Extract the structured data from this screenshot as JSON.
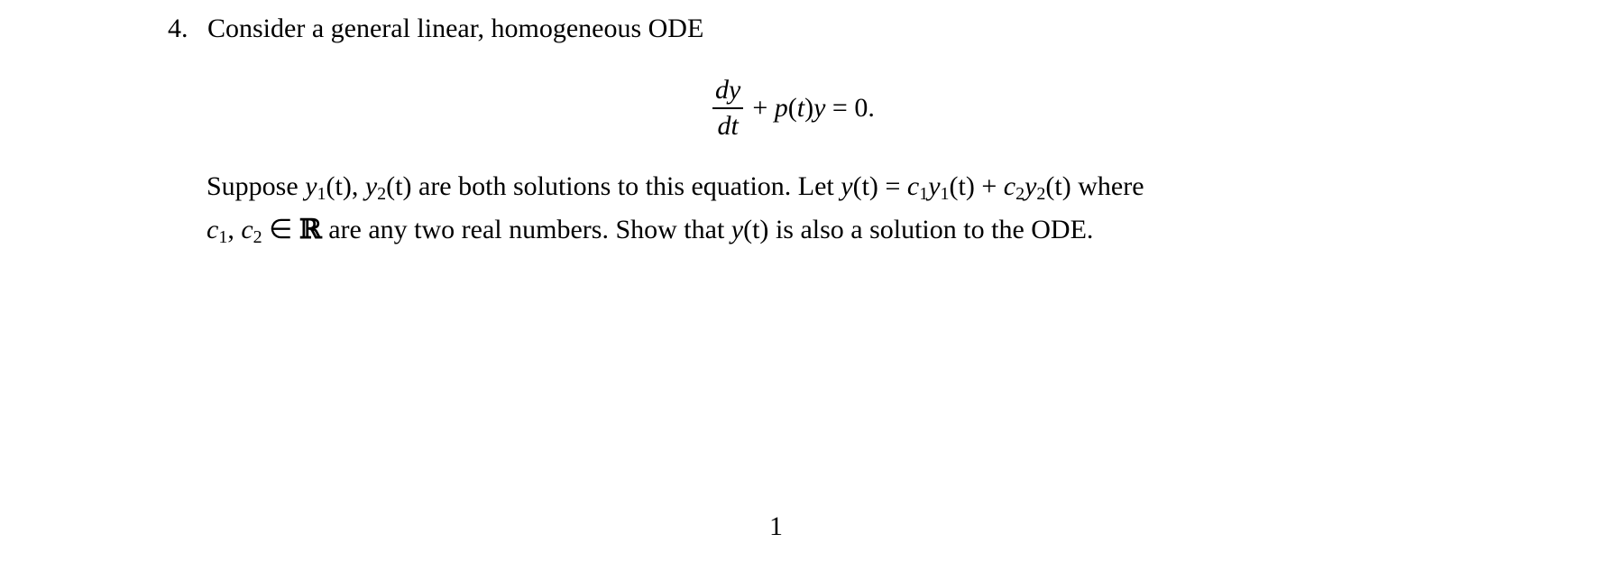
{
  "document": {
    "problem": {
      "number": "4.",
      "lead": "Consider a general linear, homogeneous ODE",
      "equation": {
        "numerator": "dy",
        "denominator": "dt",
        "rest": {
          "plus": "+",
          "p": "p",
          "t_open": "(",
          "t": "t",
          "t_close": ")",
          "y": "y",
          "equals": "=",
          "zero": "0."
        }
      },
      "paragraph": {
        "line1": {
          "suppose": "Suppose",
          "y1": "y",
          "y1_sub": "1",
          "y1_arg": "(t),",
          "y2": "y",
          "y2_sub": "2",
          "y2_arg": "(t)",
          "middle": "are both solutions to this equation. Let",
          "yt": "y",
          "yt_arg": "(t)",
          "equals": "=",
          "c1": "c",
          "c1_sub": "1",
          "c1y1": "y",
          "c1y1_sub": "1",
          "c1y1_arg": "(t)",
          "plus": "+",
          "c2": "c",
          "c2_sub": "2",
          "c2y2": "y",
          "c2y2_sub": "2",
          "c2y2_arg": "(t)",
          "where": "where"
        },
        "line2": {
          "c1": "c",
          "c1_sub": "1",
          "comma": ",",
          "c2": "c",
          "c2_sub": "2",
          "in": "∈",
          "reals": "ℝ",
          "middle": "are any two real numbers. Show that",
          "yt": "y",
          "yt_arg": "(t)",
          "end": "is also a solution to the ODE."
        }
      }
    },
    "page_number": "1"
  }
}
